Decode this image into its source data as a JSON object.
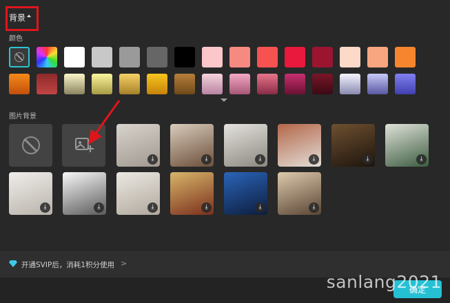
{
  "header": {
    "title": "背景"
  },
  "colors_label": "颜色",
  "image_bg_label": "图片背景",
  "colors_row1": [
    "#ffffff",
    "#c8c8c8",
    "#9a9a9a",
    "#666666",
    "#000000",
    "#fbc7ca",
    "#f68a80",
    "#f65252",
    "#e8193c",
    "#9b1530",
    "#fcd9c8",
    "#f7a680",
    "#f6852e"
  ],
  "colors_row2": [
    [
      "#f58a18",
      "#c2500d"
    ],
    [
      "#8d2a2a",
      "#c24444"
    ],
    [
      "#faf6c8",
      "#8b8460"
    ],
    [
      "#faf59c",
      "#a89a45"
    ],
    [
      "#f5d065",
      "#a7812a"
    ],
    [
      "#f7c51e",
      "#c7830a"
    ],
    [
      "#b77e3a",
      "#6f4a1a"
    ],
    [
      "#f6d3dc",
      "#b884a3"
    ],
    [
      "#f3a8c4",
      "#a65777"
    ],
    [
      "#e77489",
      "#8a2c47"
    ],
    [
      "#c6306f",
      "#6b1033"
    ],
    [
      "#7a1628",
      "#3a0a14"
    ],
    [
      "#f4f4ff",
      "#8a8ab0"
    ],
    [
      "#c8c8f8",
      "#5858a0"
    ],
    [
      "#8080f0",
      "#4040b0"
    ]
  ],
  "image_tiles": [
    {
      "name": "tile-wall-arch",
      "colors": [
        "#d8d3cc",
        "#a09890"
      ]
    },
    {
      "name": "tile-vase-window",
      "colors": [
        "#d9cbbc",
        "#6b4f3a"
      ]
    },
    {
      "name": "tile-white-room",
      "colors": [
        "#e4e2dd",
        "#8c8881"
      ]
    },
    {
      "name": "tile-brick-arch",
      "colors": [
        "#b4674a",
        "#e2ddd6"
      ]
    },
    {
      "name": "tile-warm-lamp",
      "colors": [
        "#6e5030",
        "#1d140d"
      ]
    },
    {
      "name": "tile-plant-shelf",
      "colors": [
        "#dfe2d9",
        "#3d5d41"
      ]
    },
    {
      "name": "tile-bright-shelf",
      "colors": [
        "#f0eeea",
        "#b8b2aa"
      ]
    },
    {
      "name": "tile-white-door",
      "colors": [
        "#f8f8f8",
        "#5a5a5a"
      ]
    },
    {
      "name": "tile-curtain",
      "colors": [
        "#ece8e2",
        "#b0a89d"
      ]
    },
    {
      "name": "tile-christmas",
      "colors": [
        "#d7b56a",
        "#7a2f1c"
      ]
    },
    {
      "name": "tile-ocean-window",
      "colors": [
        "#2a64b8",
        "#0d1d3d"
      ]
    },
    {
      "name": "tile-beige-lamp",
      "colors": [
        "#ddc9ac",
        "#5a4535"
      ]
    }
  ],
  "footer": {
    "vip_text": "开通SVIP后，消耗1积分使用",
    "chevron": ">",
    "confirm_label": "确定"
  },
  "watermark": "sanlang2021",
  "icons": {
    "no_color": "no-symbol-icon",
    "upload": "image-upload-icon",
    "download": "download-icon",
    "diamond": "diamond-icon"
  }
}
